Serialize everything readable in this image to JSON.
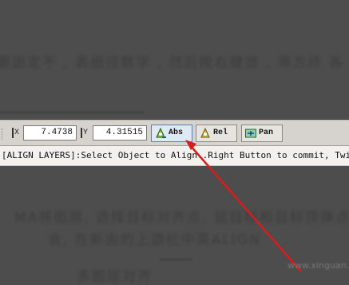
{
  "background_text": {
    "line1": "要固定不 , 表细径数字 , 然后按右键退 , 等方终 各",
    "line2": "MA将图层, 选择目标对齐点, 鼠目标和目标顶弹点的",
    "line3": "会, 在新由的上游栏中英ALIGN",
    "line4": "多图层对齐"
  },
  "toolbar": {
    "x_label": "X",
    "x_value": "7.4738",
    "y_label": "Y",
    "y_value": "4.31515",
    "abs_label": "Abs",
    "rel_label": "Rel",
    "pan_label": "Pan"
  },
  "status_bar": {
    "message": "[ALIGN LAYERS]:Select Object to Align..Right Button to commit, Twice"
  },
  "annotation": {
    "arrow_color": "#d81c1c"
  },
  "watermark": {
    "text": "www.xinguan.net"
  }
}
